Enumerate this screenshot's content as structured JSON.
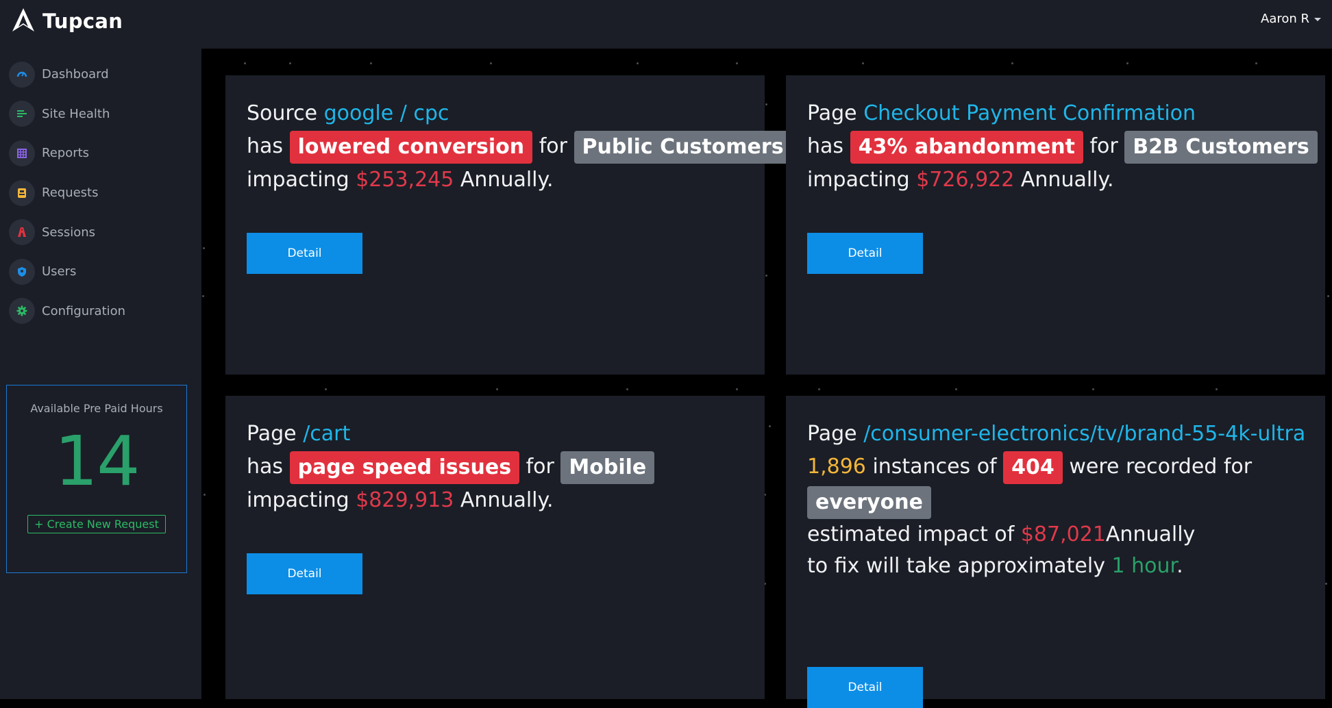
{
  "app": {
    "name": "Tupcan",
    "user": "Aaron R"
  },
  "sidebar": {
    "items": [
      {
        "label": "Dashboard",
        "icon": "gauge-icon"
      },
      {
        "label": "Site Health",
        "icon": "list-icon"
      },
      {
        "label": "Reports",
        "icon": "grid-icon"
      },
      {
        "label": "Requests",
        "icon": "ticket-icon"
      },
      {
        "label": "Sessions",
        "icon": "road-icon"
      },
      {
        "label": "Users",
        "icon": "shield-icon"
      },
      {
        "label": "Configuration",
        "icon": "gear-icon"
      }
    ],
    "hours": {
      "title": "Available Pre Paid Hours",
      "value": "14",
      "create_label": "+ Create New Request"
    }
  },
  "colors": {
    "accent": "#0d8ee6",
    "link": "#1fb6ea",
    "danger": "#e2313e",
    "muted_badge": "#6c737c",
    "success": "#2aa06a",
    "warning": "#f4b63a"
  },
  "cards": [
    {
      "subject_type": "Source",
      "subject": "google / cpc",
      "has": "has",
      "issue": "lowered conversion",
      "for": "for",
      "audience": "Public Customers",
      "impacting": "impacting",
      "amount": "$253,245",
      "period": "Annually.",
      "button": "Detail"
    },
    {
      "subject_type": "Page",
      "subject": "Checkout Payment Confirmation",
      "has": "has",
      "issue": "43% abandonment",
      "for": "for",
      "audience": "B2B Customers",
      "impacting": "impacting",
      "amount": "$726,922",
      "period": "Annually.",
      "button": "Detail"
    },
    {
      "subject_type": "Page",
      "subject": "/cart",
      "has": "has",
      "issue": "page speed issues",
      "for": "for",
      "audience": "Mobile",
      "impacting": "impacting",
      "amount": "$829,913",
      "period": "Annually.",
      "button": "Detail"
    },
    {
      "subject_type": "Page",
      "subject": "/consumer-electronics/tv/brand-55-4k-ultra",
      "count": "1,896",
      "instances_text": "instances of",
      "code": "404",
      "recorded_text": "were recorded for",
      "audience": "everyone",
      "impact_text": "estimated impact of",
      "amount": "$87,021",
      "period": "Annually",
      "fix_text": "to fix will take approximately",
      "duration": "1 hour",
      "period_end": ".",
      "button": "Detail"
    }
  ]
}
